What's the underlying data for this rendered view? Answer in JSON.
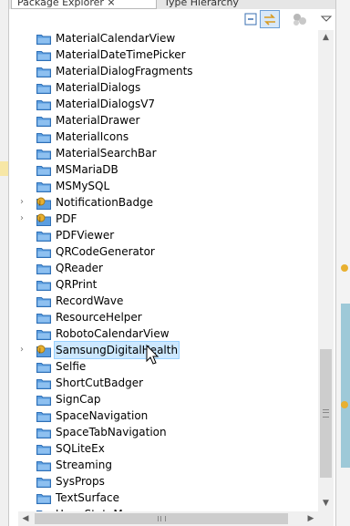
{
  "tabs": [
    {
      "label": "Package Explorer ⨯"
    },
    {
      "label": "Type Hierarchy"
    }
  ],
  "toolbar": {
    "collapse_icon": "collapse-all-icon",
    "link_icon": "link-with-editor-icon",
    "focus_icon": "focus-icon",
    "menu_icon": "view-menu-icon"
  },
  "tree": {
    "rows": [
      {
        "label": "MaterialCalendarView",
        "expandable": false,
        "icon": "folder"
      },
      {
        "label": "MaterialDateTimePicker",
        "expandable": false,
        "icon": "folder"
      },
      {
        "label": "MaterialDialogFragments",
        "expandable": false,
        "icon": "folder"
      },
      {
        "label": "MaterialDialogs",
        "expandable": false,
        "icon": "folder"
      },
      {
        "label": "MaterialDialogsV7",
        "expandable": false,
        "icon": "folder"
      },
      {
        "label": "MaterialDrawer",
        "expandable": false,
        "icon": "folder"
      },
      {
        "label": "MaterialIcons",
        "expandable": false,
        "icon": "folder"
      },
      {
        "label": "MaterialSearchBar",
        "expandable": false,
        "icon": "folder"
      },
      {
        "label": "MSMariaDB",
        "expandable": false,
        "icon": "folder"
      },
      {
        "label": "MSMySQL",
        "expandable": false,
        "icon": "folder"
      },
      {
        "label": "NotificationBadge",
        "expandable": true,
        "icon": "project"
      },
      {
        "label": "PDF",
        "expandable": true,
        "icon": "project"
      },
      {
        "label": "PDFViewer",
        "expandable": false,
        "icon": "folder"
      },
      {
        "label": "QRCodeGenerator",
        "expandable": false,
        "icon": "folder"
      },
      {
        "label": "QReader",
        "expandable": false,
        "icon": "folder"
      },
      {
        "label": "QRPrint",
        "expandable": false,
        "icon": "folder"
      },
      {
        "label": "RecordWave",
        "expandable": false,
        "icon": "folder"
      },
      {
        "label": "ResourceHelper",
        "expandable": false,
        "icon": "folder"
      },
      {
        "label": "RobotoCalendarView",
        "expandable": false,
        "icon": "folder"
      },
      {
        "label": "SamsungDigitalHealth",
        "expandable": true,
        "icon": "project",
        "selected": true
      },
      {
        "label": "Selfie",
        "expandable": false,
        "icon": "folder"
      },
      {
        "label": "ShortCutBadger",
        "expandable": false,
        "icon": "folder"
      },
      {
        "label": "SignCap",
        "expandable": false,
        "icon": "folder"
      },
      {
        "label": "SpaceNavigation",
        "expandable": false,
        "icon": "folder"
      },
      {
        "label": "SpaceTabNavigation",
        "expandable": false,
        "icon": "folder"
      },
      {
        "label": "SQLiteEx",
        "expandable": false,
        "icon": "folder"
      },
      {
        "label": "Streaming",
        "expandable": false,
        "icon": "folder"
      },
      {
        "label": "SysProps",
        "expandable": false,
        "icon": "folder"
      },
      {
        "label": "TextSurface",
        "expandable": false,
        "icon": "folder"
      },
      {
        "label": "UnnnStateM...",
        "expandable": false,
        "icon": "folder"
      }
    ]
  },
  "scroll": {
    "vertical_fraction": 0.66,
    "horizontal_fraction": 0.0
  },
  "colors": {
    "selection_bg": "#cde8ff",
    "folder_blue": "#4a8fd8",
    "project_yellow": "#e8b030"
  }
}
